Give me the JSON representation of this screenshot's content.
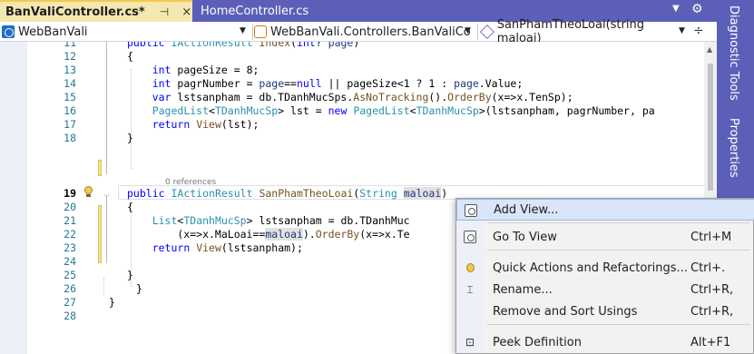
{
  "tabs": {
    "active": {
      "title": "BanValiController.cs*",
      "pin": "⊣",
      "close": "×"
    },
    "inactive": {
      "title": "HomeController.cs"
    }
  },
  "navbar": {
    "project": "WebBanVali",
    "class_scope": "WebBanVali.Controllers.BanValiCo",
    "member_scope": "SanPhamTheoLoai(string maloai)"
  },
  "sidepanel": {
    "tabs": [
      "Diagnostic Tools",
      "Properties"
    ]
  },
  "editor": {
    "lines": [
      {
        "n": "11",
        "text": "    public IActionResult Index(int? page)"
      },
      {
        "n": "12",
        "text": "    {"
      },
      {
        "n": "13",
        "text": "        int pageSize = 8;"
      },
      {
        "n": "14",
        "text": "        int pagrNumber = page==null || pageSize<1 ? 1 : page.Value;"
      },
      {
        "n": "15",
        "text": "        var lstsanpham = db.TDanhMucSps.AsNoTracking().OrderBy(x=>x.TenSp);"
      },
      {
        "n": "16",
        "text": "        PagedList<TDanhMucSp> lst = new PagedList<TDanhMucSp>(lstsanpham, pagrNumber, pa"
      },
      {
        "n": "17",
        "text": "        return View(lst);"
      },
      {
        "n": "18",
        "text": "    }"
      },
      {
        "n": "19",
        "text": "    public IActionResult SanPhamTheoLoai(String maloai)"
      },
      {
        "n": "20",
        "text": "    {"
      },
      {
        "n": "21",
        "text": "        List<TDanhMucSp> lstsanpham = db.TDanhMuc"
      },
      {
        "n": "22",
        "text": "            (x=>x.MaLoai==maloai).OrderBy(x=>x.Te"
      },
      {
        "n": "23",
        "text": "        return View(lstsanpham);"
      },
      {
        "n": "24",
        "text": ""
      },
      {
        "n": "25",
        "text": "    }"
      },
      {
        "n": "26",
        "text": "}"
      },
      {
        "n": "27",
        "text": "}"
      },
      {
        "n": "28",
        "text": ""
      }
    ],
    "references_label": "0 references"
  },
  "context_menu": {
    "items": [
      {
        "label": "Add View...",
        "shortcut": "",
        "icon": "add-view-icon"
      },
      {
        "label": "Go To View",
        "shortcut": "Ctrl+M",
        "icon": "view-icon"
      },
      {
        "label": "Quick Actions and Refactorings...",
        "shortcut": "Ctrl+.",
        "icon": "lightbulb-icon"
      },
      {
        "label": "Rename...",
        "shortcut": "Ctrl+R,",
        "icon": "rename-icon"
      },
      {
        "label": "Remove and Sort Usings",
        "shortcut": "Ctrl+R,",
        "icon": ""
      },
      {
        "label": "Peek Definition",
        "shortcut": "Alt+F1",
        "icon": "peek-icon"
      }
    ]
  },
  "colors": {
    "accent": "#5c5fb8",
    "active_tab": "#f3e9b0",
    "keyword": "#0000ff",
    "type": "#2b91af",
    "line_number": "#237893",
    "menu_hover": "#d9e5f8"
  }
}
